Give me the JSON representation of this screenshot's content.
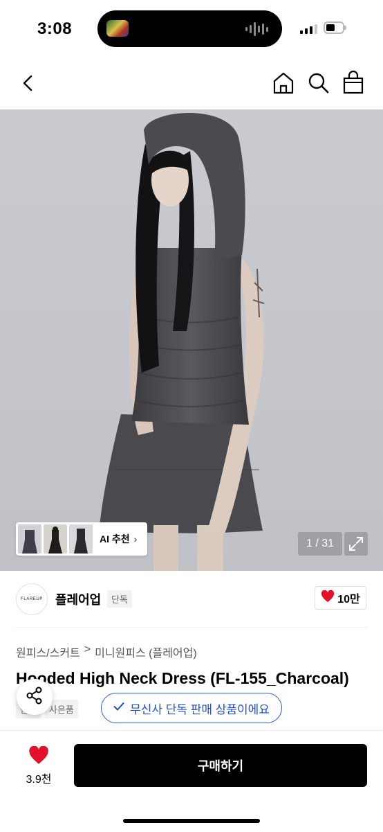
{
  "status_bar": {
    "time": "3:08"
  },
  "product_image": {
    "counter": "1 / 31",
    "ai_recommend_label": "AI 추천",
    "ai_recommend_chevron": "›"
  },
  "brand": {
    "logo_text": "FLAREUP",
    "name": "플레어업",
    "badge": "단독",
    "like_count": "10만"
  },
  "breadcrumb": {
    "category": "원피스/스커트",
    "separator": ">",
    "subcategory": "미니원피스 (플레어업)"
  },
  "product": {
    "title": "Hooded High Neck Dress (FL-155_Charcoal)",
    "tags": [
      "단독",
      "사은품"
    ]
  },
  "toast": {
    "text": "무신사 단독 판매 상품이에요"
  },
  "bottom_bar": {
    "wish_count": "3.9천",
    "buy_label": "구매하기"
  },
  "colors": {
    "accent_blue": "#2b5bd7",
    "heart_red": "#e5102c",
    "buy_button": "#000000"
  },
  "icons": [
    "back-icon",
    "home-icon",
    "search-icon",
    "shopping-bag-icon",
    "heart-icon",
    "share-icon",
    "check-icon",
    "expand-icon"
  ]
}
